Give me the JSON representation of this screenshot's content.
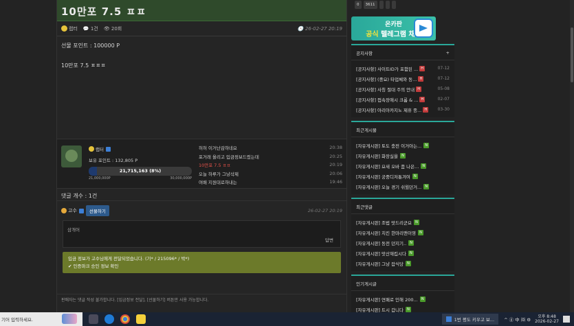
{
  "post": {
    "title": "10만포 7.5 ㅍㅍ",
    "author": "랩터",
    "comments": "1건",
    "views": "20회",
    "date": "26-02-27 20:19",
    "body_line1": "선물 포인트 : 100000 P",
    "body_line2": "10만포 7.5 ㅍㅍㅍ"
  },
  "author_box": {
    "name": "랩터",
    "points": "보유 포인트 : 132,805 P",
    "level_text": "21,715,163 (8%)",
    "level_progress": 0.08,
    "range_min": "21,000,000P",
    "range_max": "30,000,000P",
    "recent_posts": [
      {
        "title": "허허 이거난감하네요",
        "date": "20:38",
        "active": false
      },
      {
        "title": "포거래 올리고 입금정보드렸는데",
        "date": "20:25",
        "active": false
      },
      {
        "title": "10만포 7.5 ㅍㅍ",
        "date": "20:19",
        "active": true
      },
      {
        "title": "오늘 하루가 그냥삭제",
        "date": "20:06",
        "active": false
      },
      {
        "title": "여배 지원대로하내는",
        "date": "19:46",
        "active": false
      }
    ]
  },
  "comments_section": {
    "count_label": "댓글 개수 : 1건",
    "commenter": "고수",
    "gift_button": "선물하기",
    "date": "26-02-27 20:19",
    "comment_text": "삼개어",
    "reply_label": "답변",
    "notice_line1": "입금 정보가 고수님에게 전달되었습니다. (기* / 215096* / 박*)",
    "notice_line2": "✔ 인증마크 승인 정보 확인",
    "footer_note": "판매자는 댓글 작성 불가합니다. [입금정보 전달], [선물하기] 버튼만 사용 가능합니다."
  },
  "sidebar": {
    "top_icons": [
      "0",
      "3611",
      "",
      "",
      ""
    ],
    "banner_line1": "온카판",
    "banner_line2a": "공식",
    "banner_line2b": "텔레그램 채널",
    "notices_title": "공지사항",
    "notices": [
      {
        "title": "[공지사항] 사이트ID가 포함된 ...",
        "date": "07-12"
      },
      {
        "title": "[공지사항] (중요) 타업체와 동...",
        "date": "07-12"
      },
      {
        "title": "[공지사항] 사칭 절대 주의 안내",
        "date": "05-08"
      },
      {
        "title": "[공지사항] 접속장애시 크롬 & ...",
        "date": "02-07"
      },
      {
        "title": "[공지사항] 아리아카지노 제휴 종...",
        "date": "03-30"
      }
    ],
    "recent_posts_title": "최근게시물",
    "recent_posts": [
      "[자유게시판] 토도 충전 이거아는...",
      "[자유게시판] 화장실을",
      "[자유게시판] 요새 오바 좀 나은...",
      "[자유게시판] 궁중디저통겨여",
      "[자유게시판] 오늘 경기 쉬웠던거..."
    ],
    "recent_comments_title": "최근댓글",
    "recent_comments": [
      "[자유게시판] 조법 맛드리군요",
      "[자유게시판] 치킨 한마리맨이영",
      "[자유게시판] 동전 던지기..",
      "[자유게시판] 맛산재킵시다",
      "[자유게시판] 그냥 잡식당"
    ],
    "popular_title": "인기게시글",
    "popular": [
      "[자유게시판] 연패로 인해 200...",
      "[자유게시판] 트시 갑니다",
      "[자유게시판] 진짜 생일이려서 1..."
    ]
  },
  "taskbar": {
    "search_placeholder": "기어 입력하세요.",
    "app_title": "1번 평도 키우고 보...",
    "tray_text": "^ ⓖ 中 ㈜ ⚙",
    "time": "오후 8:48",
    "date": "2026-02-27"
  },
  "colors": {
    "accent": "#2aa89a",
    "title_bg": "#2f4a2b",
    "notice_bg": "#6c7a2a",
    "gift_btn": "#2d5a8c"
  }
}
